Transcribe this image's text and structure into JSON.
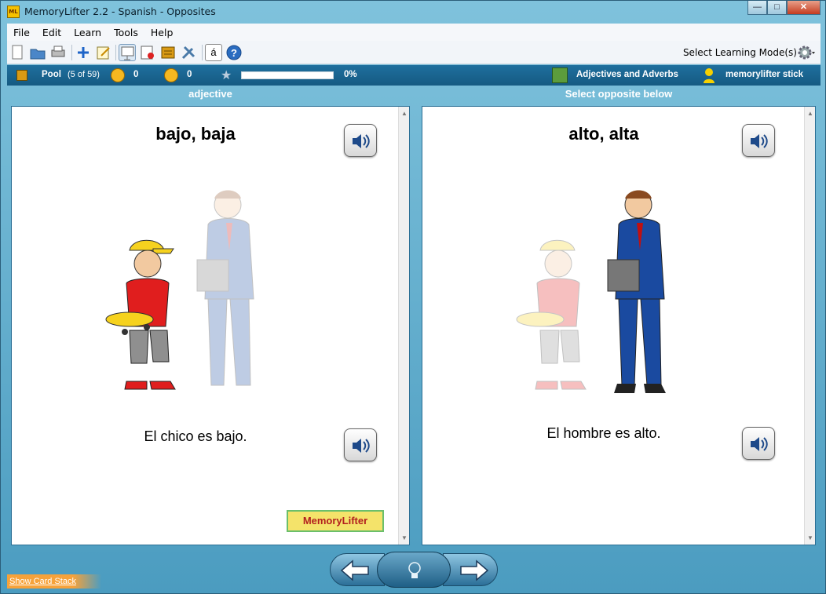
{
  "window": {
    "title": "MemoryLifter 2.2 - Spanish - Opposites",
    "app_icon_text": "ML",
    "minimize": "—",
    "maximize": "□",
    "close": "✕"
  },
  "menu": {
    "items": [
      "File",
      "Edit",
      "Learn",
      "Tools",
      "Help"
    ]
  },
  "toolbar": {
    "select_mode_label": "Select Learning Mode(s)",
    "accent_char": "á"
  },
  "status": {
    "pool_label": "Pool",
    "pool_count": "(5 of 59)",
    "correct_count": "0",
    "wrong_count": "0",
    "progress_percent": 0,
    "progress_label": "0%",
    "category": "Adjectives and Adverbs",
    "user": "memorylifter stick"
  },
  "question": {
    "header": "adjective",
    "word": "bajo, baja",
    "sentence": "El chico es bajo."
  },
  "answer": {
    "header": "Select opposite below",
    "word": "alto, alta",
    "sentence": "El hombre es alto."
  },
  "logo": {
    "text": "MemoryLifter"
  },
  "footer": {
    "show_card_stack": "Show Card Stack"
  },
  "colors": {
    "frame": "#4b9cc0",
    "statusbar": "#1a6592",
    "progress_fill": "#4caf50"
  }
}
